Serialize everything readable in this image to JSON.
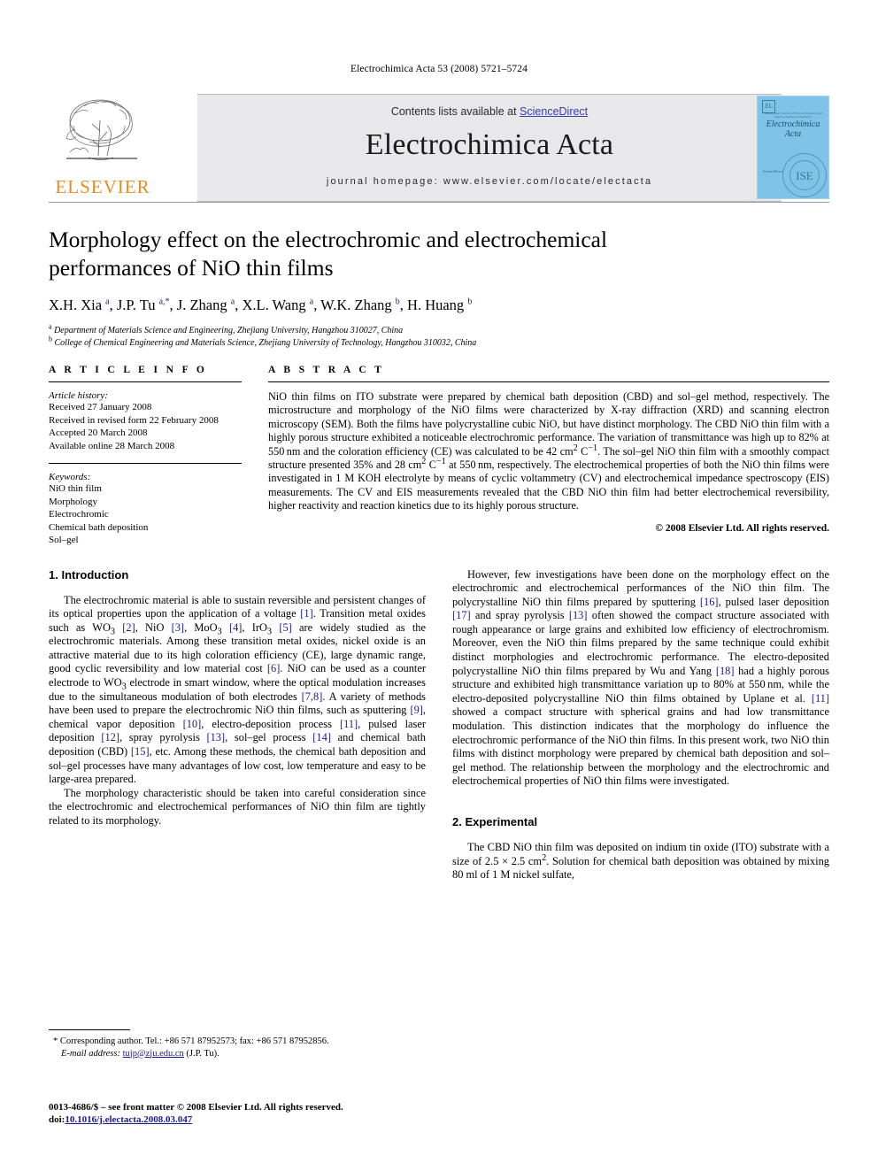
{
  "running_head": "Electrochimica Acta 53 (2008) 5721–5724",
  "masthead": {
    "contents_prefix": "Contents lists available at ",
    "sciencedirect": "ScienceDirect",
    "journal_title": "Electrochimica Acta",
    "homepage": "journal homepage: www.elsevier.com/locate/electacta",
    "publisher_logo_text": "ELSEVIER",
    "cover": {
      "title_line1": "Electrochimica",
      "title_line2": "Acta",
      "micro_text": "International Journal of Electrochemistry and Interfacial Electrochemistry",
      "el_mark": "EL",
      "sciencedirect_mark": "ScienceDirect",
      "seal_text": "ISE"
    },
    "accent_color": "#3b3bb0",
    "logo_color": "#f08a1e",
    "band_color": "#e8e8ea",
    "cover_color": "#7fc3e8"
  },
  "article": {
    "title": "Morphology effect on the electrochromic and electrochemical performances of NiO thin films",
    "authors_html": "X.H. Xia <sup>a</sup>, J.P. Tu <sup>a,*</sup>, J. Zhang <sup>a</sup>, X.L. Wang <sup>a</sup>, W.K. Zhang <sup>b</sup>, H. Huang <sup>b</sup>",
    "affiliation_a": "Department of Materials Science and Engineering, Zhejiang University, Hangzhou 310027, China",
    "affiliation_b": "College of Chemical Engineering and Materials Science, Zhejiang University of Technology, Hangzhou 310032, China",
    "affiliation_a_marker": "a",
    "affiliation_b_marker": "b"
  },
  "article_info": {
    "heading": "A R T I C L E   I N F O",
    "history_label": "Article history:",
    "history": [
      "Received 27 January 2008",
      "Received in revised form 22 February 2008",
      "Accepted 20 March 2008",
      "Available online 28 March 2008"
    ],
    "keywords_label": "Keywords:",
    "keywords": [
      "NiO thin film",
      "Morphology",
      "Electrochromic",
      "Chemical bath deposition",
      "Sol–gel"
    ]
  },
  "abstract": {
    "heading": "A B S T R A C T",
    "text": "NiO thin films on ITO substrate were prepared by chemical bath deposition (CBD) and sol–gel method, respectively. The microstructure and morphology of the NiO films were characterized by X-ray diffraction (XRD) and scanning electron microscopy (SEM). Both the films have polycrystalline cubic NiO, but have distinct morphology. The CBD NiO thin film with a highly porous structure exhibited a noticeable electrochromic performance. The variation of transmittance was high up to 82% at 550 nm and the coloration efficiency (CE) was calculated to be 42 cm2 C−1. The sol–gel NiO thin film with a smoothly compact structure presented 35% and 28 cm2 C−1 at 550 nm, respectively. The electrochemical properties of both the NiO thin films were investigated in 1 M KOH electrolyte by means of cyclic voltammetry (CV) and electrochemical impedance spectroscopy (EIS) measurements. The CV and EIS measurements revealed that the CBD NiO thin film had better electrochemical reversibility, higher reactivity and reaction kinetics due to its highly porous structure.",
    "copyright": "© 2008 Elsevier Ltd. All rights reserved."
  },
  "sections": {
    "introduction_heading": "1.  Introduction",
    "experimental_heading": "2.  Experimental",
    "intro_p1": "The electrochromic material is able to sustain reversible and persistent changes of its optical properties upon the application of a voltage [1]. Transition metal oxides such as WO3 [2], NiO [3], MoO3 [4], IrO3 [5] are widely studied as the electrochromic materials. Among these transition metal oxides, nickel oxide is an attractive material due to its high coloration efficiency (CE), large dynamic range, good cyclic reversibility and low material cost [6]. NiO can be used as a counter electrode to WO3 electrode in smart window, where the optical modulation increases due to the simultaneous modulation of both electrodes [7,8]. A variety of methods have been used to prepare the electrochromic NiO thin films, such as sputtering [9], chemical vapor deposition [10], electro-deposition process [11], pulsed laser deposition [12], spray pyrolysis [13], sol–gel process [14] and chemical bath deposition (CBD) [15], etc. Among these methods, the chemical bath deposition and sol–gel processes have many advantages of low cost, low temperature and easy to be large-area prepared.",
    "intro_p2": "The morphology characteristic should be taken into careful consideration since the electrochromic and electrochemical performances of NiO thin film are tightly related to its morphology.",
    "intro_p3": "However, few investigations have been done on the morphology effect on the electrochromic and electrochemical performances of the NiO thin film. The polycrystalline NiO thin films prepared by sputtering [16], pulsed laser deposition [17] and spray pyrolysis [13] often showed the compact structure associated with rough appearance or large grains and exhibited low efficiency of electrochromism. Moreover, even the NiO thin films prepared by the same technique could exhibit distinct morphologies and electrochromic performance. The electro-deposited polycrystalline NiO thin films prepared by Wu and Yang [18] had a highly porous structure and exhibited high transmittance variation up to 80% at 550 nm, while the electro-deposited polycrystalline NiO thin films obtained by Uplane et al. [11] showed a compact structure with spherical grains and had low transmittance modulation. This distinction indicates that the morphology do influence the electrochromic performance of the NiO thin films. In this present work, two NiO thin films with distinct morphology were prepared by chemical bath deposition and sol–gel method. The relationship between the morphology and the electrochromic and electrochemical properties of NiO thin films were investigated.",
    "exp_p1": "The CBD NiO thin film was deposited on indium tin oxide (ITO) substrate with a size of 2.5 × 2.5 cm2. Solution for chemical bath deposition was obtained by mixing 80 ml of 1 M nickel sulfate,"
  },
  "footer": {
    "corresponding_marker": "*",
    "corresponding_text": "Corresponding author. Tel.: +86 571 87952573; fax: +86 571 87952856.",
    "email_label": "E-mail address:",
    "email": "tujp@zju.edu.cn",
    "email_suffix": "(J.P. Tu).",
    "issn_line": "0013-4686/$ – see front matter © 2008 Elsevier Ltd. All rights reserved.",
    "doi_label": "doi:",
    "doi": "10.1016/j.electacta.2008.03.047"
  }
}
